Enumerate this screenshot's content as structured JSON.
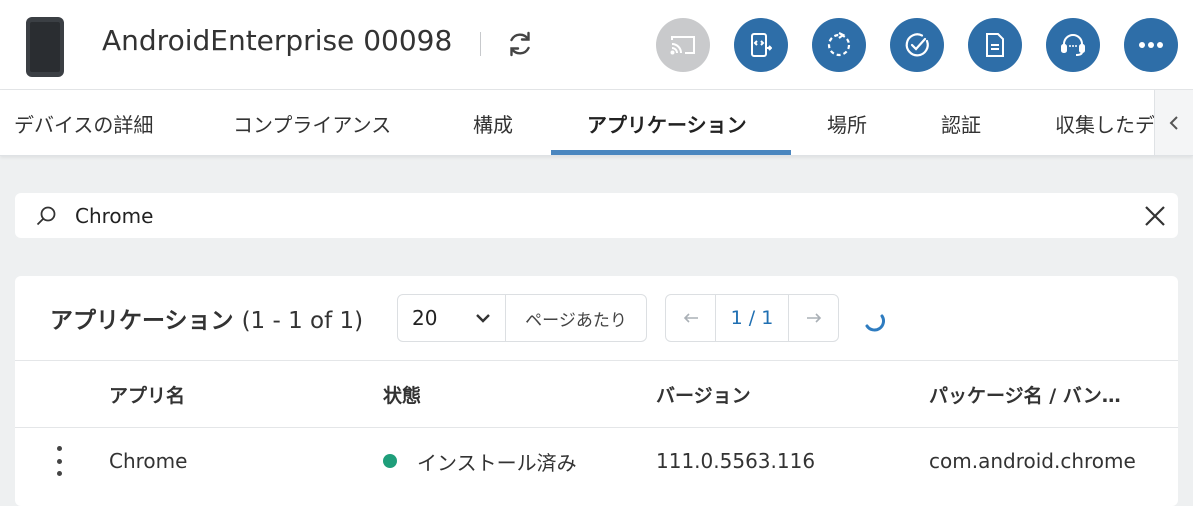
{
  "header": {
    "device_title": "AndroidEnterprise 00098",
    "actions": [
      {
        "icon": "cast-icon",
        "disabled": true
      },
      {
        "icon": "remote-code-icon",
        "disabled": false
      },
      {
        "icon": "sync-dashed-icon",
        "disabled": false
      },
      {
        "icon": "check-circle-icon",
        "disabled": false
      },
      {
        "icon": "document-icon",
        "disabled": false
      },
      {
        "icon": "headset-icon",
        "disabled": false
      },
      {
        "icon": "more-icon",
        "disabled": false
      }
    ],
    "accent_color": "#2e6ea8"
  },
  "tabs": [
    {
      "label": "デバイスの詳細",
      "active": false
    },
    {
      "label": "コンプライアンス",
      "active": false
    },
    {
      "label": "構成",
      "active": false
    },
    {
      "label": "アプリケーション",
      "active": true
    },
    {
      "label": "場所",
      "active": false
    },
    {
      "label": "認証",
      "active": false
    },
    {
      "label": "収集したデ",
      "active": false
    }
  ],
  "search": {
    "value": "Chrome"
  },
  "apps": {
    "title": "アプリケーション",
    "range": "(1 - 1 of 1)",
    "page_size": "20",
    "page_size_label": "ページあたり",
    "page_indicator": "1 / 1",
    "columns": [
      "アプリ名",
      "状態",
      "バージョン",
      "パッケージ名 / バン…"
    ],
    "rows": [
      {
        "name": "Chrome",
        "status": "インストール済み",
        "status_color": "#1f9e7a",
        "version": "111.0.5563.116",
        "package": "com.android.chrome"
      }
    ]
  }
}
